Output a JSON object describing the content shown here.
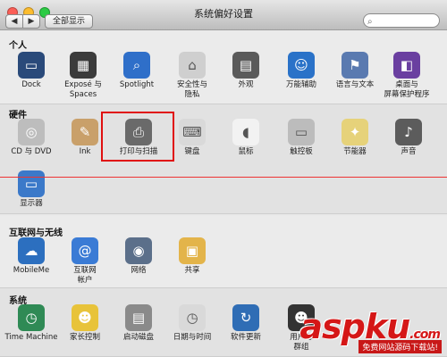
{
  "window": {
    "title": "系统偏好设置"
  },
  "toolbar": {
    "back": "◀",
    "forward": "▶",
    "show_all": "全部显示"
  },
  "sections": {
    "personal": {
      "title": "个人",
      "items": [
        {
          "label": "Dock",
          "icon": "dock-icon",
          "color": "#2a4a7a"
        },
        {
          "label": "Exposé 与\nSpaces",
          "icon": "expose-icon",
          "color": "#3b3b3b"
        },
        {
          "label": "Spotlight",
          "icon": "spotlight-icon",
          "color": "#2f6fc9"
        },
        {
          "label": "安全性与\n隐私",
          "icon": "security-icon",
          "color": "#cfcfcf"
        },
        {
          "label": "外观",
          "icon": "appearance-icon",
          "color": "#5a5a5a"
        },
        {
          "label": "万能辅助",
          "icon": "accessibility-icon",
          "color": "#2a72c8"
        },
        {
          "label": "语言与文本",
          "icon": "language-icon",
          "color": "#5a7ab0"
        },
        {
          "label": "桌面与\n屏幕保护程序",
          "icon": "desktop-icon",
          "color": "#6a3fa0"
        }
      ]
    },
    "hardware": {
      "title": "硬件",
      "items": [
        {
          "label": "CD 与 DVD",
          "icon": "cd-icon",
          "color": "#bdbdbd"
        },
        {
          "label": "Ink",
          "icon": "ink-icon",
          "color": "#c9a06a"
        },
        {
          "label": "打印与扫描",
          "icon": "printer-icon",
          "color": "#6a6a6a"
        },
        {
          "label": "键盘",
          "icon": "keyboard-icon",
          "color": "#d9d9d9"
        },
        {
          "label": "鼠标",
          "icon": "mouse-icon",
          "color": "#f2f2f2"
        },
        {
          "label": "触控板",
          "icon": "trackpad-icon",
          "color": "#bcbcbc"
        },
        {
          "label": "节能器",
          "icon": "energy-icon",
          "color": "#e6d27a"
        },
        {
          "label": "声音",
          "icon": "sound-icon",
          "color": "#5c5c5c"
        },
        {
          "label": "显示器",
          "icon": "display-icon",
          "color": "#3b79c9"
        }
      ]
    },
    "internet": {
      "title": "互联网与无线",
      "items": [
        {
          "label": "MobileMe",
          "icon": "cloud-icon",
          "color": "#2c6fbf"
        },
        {
          "label": "互联网\n帐户",
          "icon": "at-icon",
          "color": "#3a7bd5"
        },
        {
          "label": "网络",
          "icon": "network-icon",
          "color": "#5b6f8a"
        },
        {
          "label": "共享",
          "icon": "sharing-icon",
          "color": "#e3b44a"
        }
      ]
    },
    "system": {
      "title": "系统",
      "items": [
        {
          "label": "Time Machine",
          "icon": "timemachine-icon",
          "color": "#2f8a55"
        },
        {
          "label": "家长控制",
          "icon": "parental-icon",
          "color": "#e8c33a"
        },
        {
          "label": "启动磁盘",
          "icon": "disk-icon",
          "color": "#8a8a8a"
        },
        {
          "label": "日期与时间",
          "icon": "clock-icon",
          "color": "#d9d9d9"
        },
        {
          "label": "软件更新",
          "icon": "update-icon",
          "color": "#2f6db5"
        },
        {
          "label": "用户与\n群组",
          "icon": "users-icon",
          "color": "#333333"
        }
      ]
    }
  },
  "watermark": {
    "main": "aspku",
    "tld": ".com",
    "sub": "免费网站源码下载站!"
  }
}
